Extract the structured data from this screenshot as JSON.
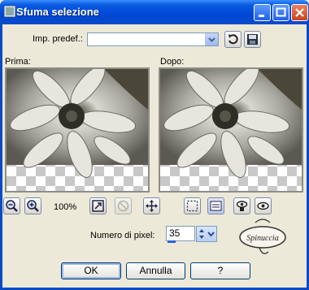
{
  "window": {
    "title": "Sfuma selezione"
  },
  "preset": {
    "label": "Imp. predef.:",
    "value": ""
  },
  "preview": {
    "before_label": "Prima:",
    "after_label": "Dopo:"
  },
  "zoom": {
    "value": "100%"
  },
  "pixels": {
    "label": "Numero di pixel:",
    "value": "35"
  },
  "signature": {
    "text": "Spinuccia"
  },
  "buttons": {
    "ok": "OK",
    "cancel": "Annulla",
    "help": "?"
  },
  "colors": {
    "title_blue": "#0046D5",
    "face": "#ECE9D8"
  }
}
